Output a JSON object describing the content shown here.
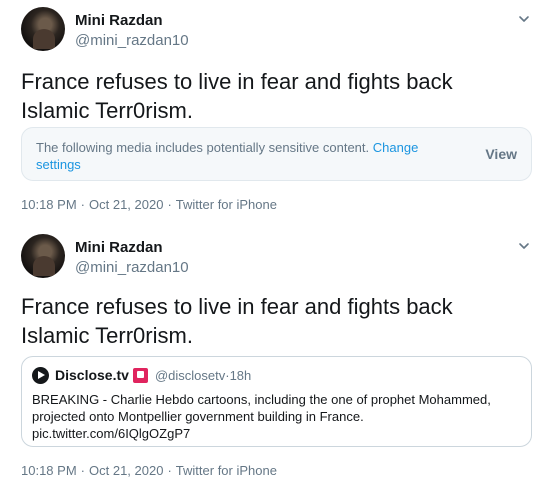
{
  "tweets": [
    {
      "author_name": "Mini Razdan",
      "author_handle": "@mini_razdan10",
      "text": "France refuses to live in fear and fights back Islamic Terr0rism.",
      "sensitive_notice": "The following media includes potentially sensitive content.",
      "sensitive_link": "Change settings",
      "view_label": "View",
      "time": "10:18 PM",
      "date": "Oct 21, 2020",
      "source": "Twitter for iPhone"
    },
    {
      "author_name": "Mini Razdan",
      "author_handle": "@mini_razdan10",
      "text": "France refuses to live in fear and fights back Islamic Terr0rism.",
      "quote": {
        "name": "Disclose.tv",
        "handle": "@disclosetv",
        "age": "18h",
        "body": "BREAKING - Charlie Hebdo cartoons, including the one of prophet Mohammed, projected onto Montpellier government building in France. pic.twitter.com/6IQlgOZgP7"
      },
      "time": "10:18 PM",
      "date": "Oct 21, 2020",
      "source": "Twitter for iPhone"
    }
  ],
  "separator": "·",
  "icons": {
    "caret": "chevron-down-icon",
    "quote_logo": "disclose-logo-icon",
    "badge": "siren-badge-icon"
  },
  "colors": {
    "text": "#14171a",
    "secondary": "#657786",
    "link": "#1b95e0",
    "border": "#e1e8ed",
    "sensitive_bg": "#f5f8fa",
    "badge": "#e0245e"
  }
}
